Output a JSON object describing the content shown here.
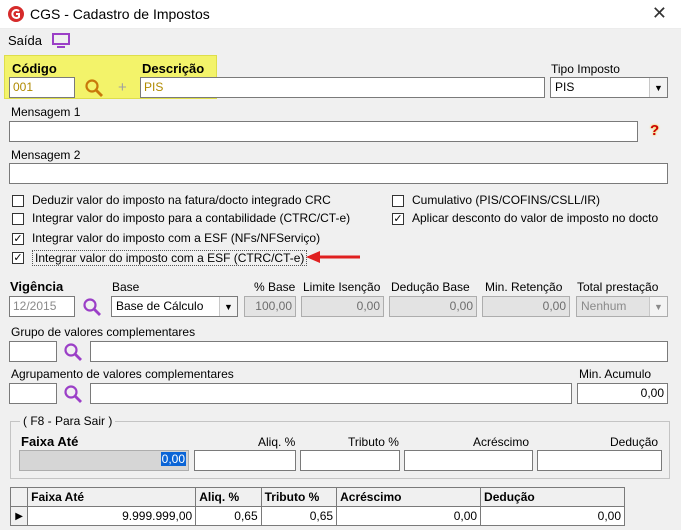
{
  "window": {
    "title": "CGS - Cadastro de Impostos",
    "close_glyph": "✕"
  },
  "menu": {
    "saida": "Saída"
  },
  "fields": {
    "codigo_label": "Código",
    "codigo_value": "001",
    "plus_glyph": "+",
    "descricao_label": "Descrição",
    "descricao_value": "PIS",
    "tipo_imposto_label": "Tipo Imposto",
    "tipo_imposto_value": "PIS",
    "mensagem1_label": "Mensagem 1",
    "mensagem1_value": "",
    "help_glyph": "?",
    "mensagem2_label": "Mensagem 2",
    "mensagem2_value": ""
  },
  "checkboxes": [
    {
      "label": "Deduzir valor do imposto na fatura/docto integrado CRC",
      "checked": false
    },
    {
      "label": "Integrar valor do imposto para a contabilidade (CTRC/CT-e)",
      "checked": false
    },
    {
      "label": "Integrar valor do imposto com a ESF (NFs/NFServiço)",
      "checked": true
    },
    {
      "label": "Integrar valor do imposto com a ESF (CTRC/CT-e)",
      "checked": true
    },
    {
      "label": "Cumulativo (PIS/COFINS/CSLL/IR)",
      "checked": false
    },
    {
      "label": "Aplicar desconto do valor de imposto no docto",
      "checked": true
    }
  ],
  "params": {
    "vigencia_label": "Vigência",
    "vigencia_value": "12/2015",
    "base_label": "Base",
    "base_value": "Base de Cálculo",
    "pct_base_label": "% Base",
    "pct_base_value": "100,00",
    "limite_isencao_label": "Limite Isenção",
    "limite_isencao_value": "0,00",
    "deducao_base_label": "Dedução Base",
    "deducao_base_value": "0,00",
    "min_retencao_label": "Min. Retenção",
    "min_retencao_value": "0,00",
    "total_prestacao_label": "Total prestação",
    "total_prestacao_value": "Nenhum"
  },
  "grupo": {
    "label": "Grupo de valores complementares",
    "code": "",
    "desc": ""
  },
  "agrupamento": {
    "label": "Agrupamento de valores complementares",
    "code": "",
    "desc": "",
    "min_acumulo_label": "Min. Acumulo",
    "min_acumulo_value": "0,00"
  },
  "faixa_group": {
    "legend": "( F8 - Para Sair )",
    "faixa_ate_label": "Faixa Até",
    "aliq_label": "Aliq. %",
    "tributo_label": "Tributo %",
    "acrescimo_label": "Acréscimo",
    "deducao_label": "Dedução",
    "faixa_ate_value": "0,00",
    "aliq_value": "",
    "tributo_value": "",
    "acrescimo_value": "",
    "deducao_value": ""
  },
  "table": {
    "headers": [
      "Faixa Até",
      "Aliq. %",
      "Tributo %",
      "Acréscimo",
      "Dedução"
    ],
    "rows": [
      {
        "indicator": "▶",
        "cells": [
          "9.999.999,00",
          "0,65",
          "0,65",
          "0,00",
          "0,00"
        ]
      }
    ]
  },
  "colors": {
    "highlight": "#f3f36a",
    "accent": "#9b3fc7",
    "arrow": "#e02020",
    "logo": "#d62b2b"
  }
}
